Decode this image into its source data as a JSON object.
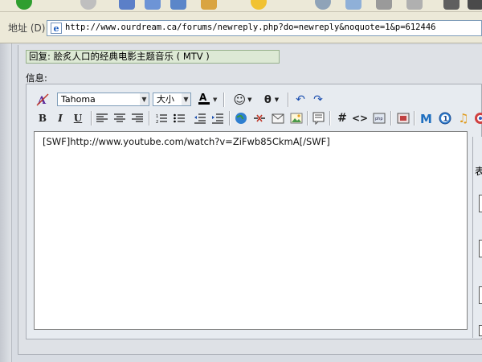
{
  "address_bar": {
    "label": "地址 (D)",
    "url": "http://www.ourdream.ca/forums/newreply.php?do=newreply&noquote=1&p=612446"
  },
  "form": {
    "subject_value": "回复: 脍炙人口的经典电影主题音乐 ( MTV )",
    "message_label": "信息:"
  },
  "editor": {
    "font_select": "Tahoma",
    "size_select": "大小",
    "content": "[SWF]http://www.youtube.com/watch?v=ZiFwb85CkmA[/SWF]",
    "colors": {
      "text_color_underline": "#000000",
      "bold_text": "#000000"
    }
  },
  "right_panel": {
    "partial_char": "表"
  }
}
